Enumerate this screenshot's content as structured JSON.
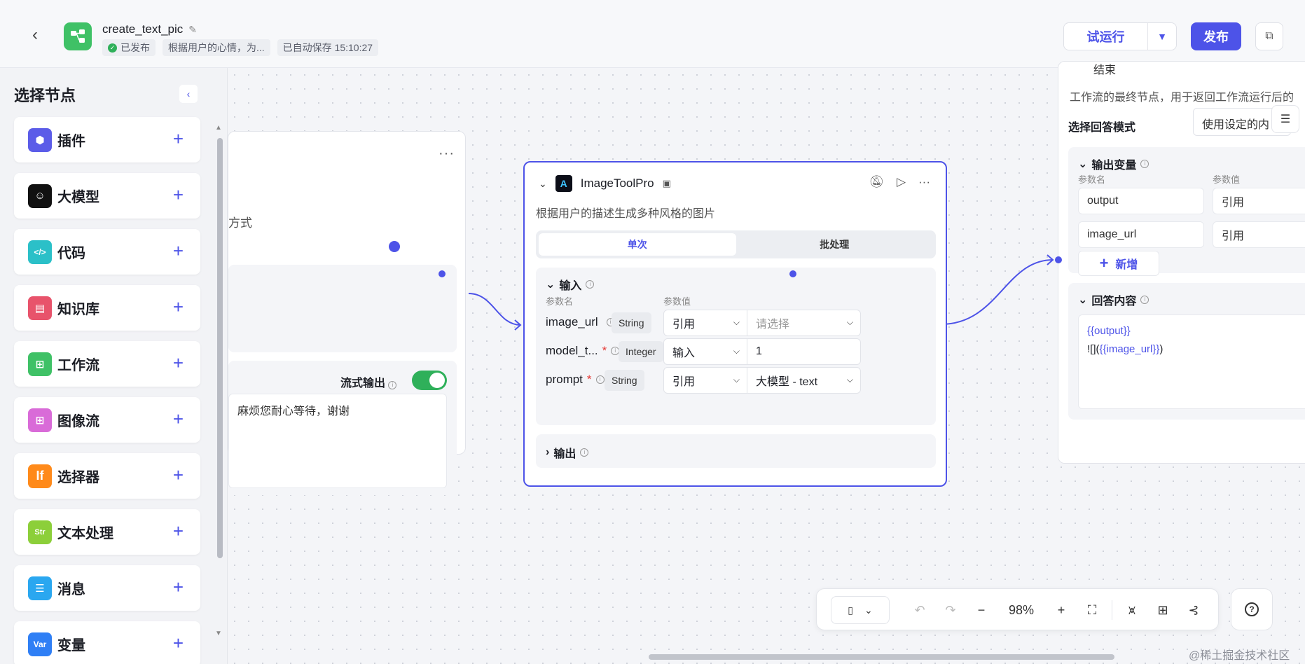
{
  "header": {
    "title": "create_text_pic",
    "status": "已发布",
    "description": "根据用户的心情，为...",
    "autosave": "已自动保存 15:10:27",
    "run_label": "试运行",
    "publish_label": "发布"
  },
  "sidebar": {
    "title": "选择节点",
    "items": [
      {
        "label": "插件",
        "color": "#5b5ce8",
        "glyph": "⬢"
      },
      {
        "label": "大模型",
        "color": "#111111",
        "glyph": "☺"
      },
      {
        "label": "代码",
        "color": "#2bc0c8",
        "glyph": "</>"
      },
      {
        "label": "知识库",
        "color": "#e8536b",
        "glyph": "▤"
      },
      {
        "label": "工作流",
        "color": "#3fc166",
        "glyph": "⊞"
      },
      {
        "label": "图像流",
        "color": "#d96bd8",
        "glyph": "⊞"
      },
      {
        "label": "选择器",
        "color": "#ff8a1a",
        "glyph": "If"
      },
      {
        "label": "文本处理",
        "color": "#8ccf3a",
        "glyph": "Str"
      },
      {
        "label": "消息",
        "color": "#2aa7f0",
        "glyph": "☰"
      },
      {
        "label": "变量",
        "color": "#2f7ff5",
        "glyph": "Var"
      }
    ]
  },
  "prev_node": {
    "label_fragment": "方式",
    "stream_label": "流式输出",
    "message": "麻烦您耐心等待，谢谢"
  },
  "image_node": {
    "name": "ImageToolPro",
    "description": "根据用户的描述生成多种风格的图片",
    "tabs": [
      "单次",
      "批处理"
    ],
    "input_title": "输入",
    "col_name": "参数名",
    "col_value": "参数值",
    "params": [
      {
        "name": "image_url",
        "required": "",
        "type": "String",
        "mode": "引用",
        "value": "请选择",
        "placeholder": true
      },
      {
        "name": "model_t...",
        "required": "*",
        "type": "Integer",
        "mode": "输入",
        "value": "1",
        "placeholder": false
      },
      {
        "name": "prompt",
        "required": "*",
        "type": "String",
        "mode": "引用",
        "value": "大模型 - text",
        "placeholder": false
      }
    ],
    "output_title": "输出"
  },
  "end_node": {
    "title": "结束",
    "description": "工作流的最终节点，用于返回工作流运行后的",
    "mode_label": "选择回答模式",
    "mode_value": "使用设定的内",
    "out_title": "输出变量",
    "col_name": "参数名",
    "col_value": "参数值",
    "vars": [
      {
        "name": "output",
        "mode": "引用"
      },
      {
        "name": "image_url",
        "mode": "引用"
      }
    ],
    "add_label": "新增",
    "answer_title": "回答内容",
    "answer_line1": "{{output}}",
    "answer_line2_prefix": "![](",
    "answer_line2_var": "{{image_url}}",
    "answer_line2_suffix": ")"
  },
  "toolbar": {
    "zoom": "98%"
  },
  "watermark": "@稀土掘金技术社区"
}
